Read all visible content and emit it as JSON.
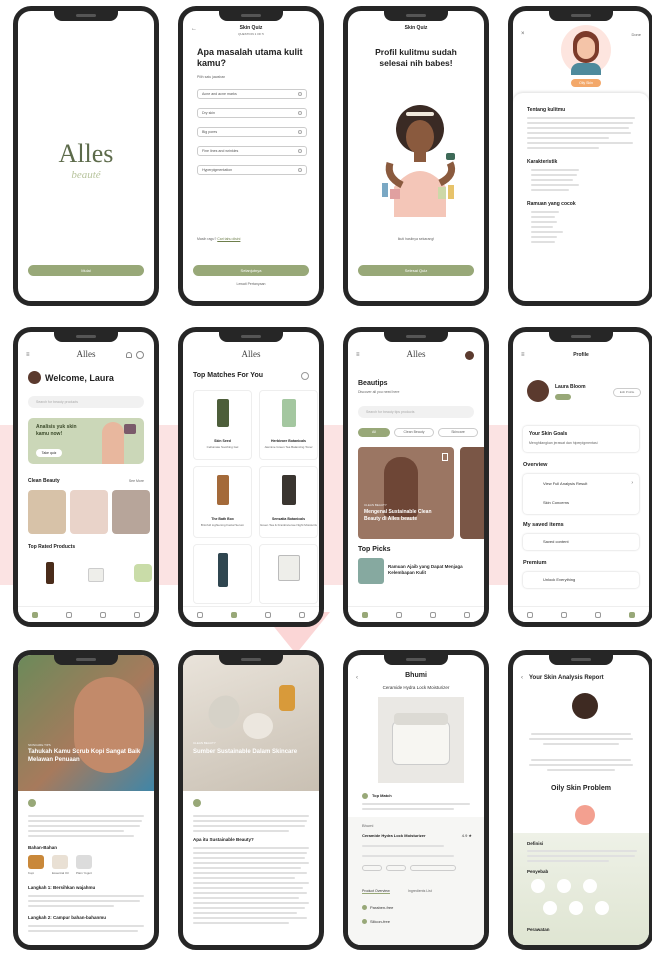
{
  "onboard": {
    "logo": "Alles",
    "logo_sub": "beauté",
    "cta": "Mulai"
  },
  "quiz": {
    "header": "Skin Quiz",
    "step": "QUESTION 1 OF 5",
    "question": "Apa masalah utama kulit kamu?",
    "hint": "Pilih satu jawaban",
    "options": [
      "Acne and acne marks",
      "Dry skin",
      "Big pores",
      "Fine lines and wrinkles",
      "Hyperpigmentation"
    ],
    "footer_q": "Masih ragu?",
    "footer_link": "Cari tahu disini",
    "next": "Selanjutnya",
    "skip": "Lewati Pertanyaan"
  },
  "done": {
    "header": "Skin Quiz",
    "title": "Profil kulitmu sudah selesai nih babes!",
    "sub": "Ikuti hasilnya sekarang!",
    "cta": "Selesai Quiz"
  },
  "detail": {
    "close": "×",
    "done": "Done",
    "badge": "Oily Skin",
    "about_title": "Tentang kulitmu",
    "char_title": "Karakteristik",
    "ing_title": "Ramuan yang cocok"
  },
  "home": {
    "logo": "Alles",
    "welcome": "Welcome, Laura",
    "search": "Search for beauty products",
    "promo": "Analisis yuk skin kamu now!",
    "promo_btn": "Take quiz",
    "clean_title": "Clean Beauty",
    "see_all": "See More",
    "top_title": "Top Rated Products"
  },
  "matches": {
    "logo": "Alles",
    "title": "Top Matches For You",
    "products": [
      {
        "name": "Skin Seed",
        "sub": "Cellumate Soothing Gel"
      },
      {
        "name": "Herbivore Botanicals",
        "sub": "Jasmine Green Tea Balancing Toner"
      },
      {
        "name": "The Bath Box",
        "sub": "Brimfull Lightening Facial Serum"
      },
      {
        "name": "Sensatia Botanicals",
        "sub": "Green Tea & Frankincense Night Moisturizer"
      }
    ]
  },
  "tips": {
    "logo": "Alles",
    "title": "Beautips",
    "sub": "Discover all you need here",
    "search": "Search for beauty tips products",
    "chips": [
      "All",
      "Clean Beauty",
      "Skincare"
    ],
    "card_tag": "CLEAN BEAUTY",
    "card_title": "Mengenal Sustainable Clean Beauty di Alles beaute",
    "picks_title": "Top Picks",
    "pick_title": "Ramuan Ajaib yang Dapat Menjaga Kelembapan Kulit"
  },
  "profile": {
    "header": "Profile",
    "name": "Laura Bloom",
    "edit": "Edit Profile",
    "goals": "Your Skin Goals",
    "goals_sub": "Menghilangkan jerawat dan hiperpigmentasi",
    "overview": "Overview",
    "ov_items": [
      "View Full Analysis Result",
      "Skin Concerns"
    ],
    "saved": "My saved items",
    "saved_item": "Saved content",
    "premium": "Premium",
    "premium_item": "Unlock Everything"
  },
  "article1": {
    "tag": "SKINCARE TIPS",
    "title": "Tahukah Kamu Scrub Kopi Sangat Baik Melawan Penuaan",
    "ing_title": "Bahan-Bahan",
    "ing": [
      "Kopi",
      "Essential Oil",
      "Plain Yogurt"
    ],
    "step1": "Langkah 1: Bersihkan wajahmu",
    "step2": "Langkah 2: Campur bahan-bahanmu"
  },
  "article2": {
    "tag": "CLEAN BEAUTY",
    "title": "Sumber Sustainable Dalam Skincare",
    "q": "Apa itu Sustainable Beauty?"
  },
  "product": {
    "brand": "Bhumi",
    "name": "Ceramide Hydra Lock Moisturizer",
    "match": "Top Match",
    "brand2": "Bhumi",
    "name2": "Ceramide Hydra Lock Moisturizer",
    "price": "4.9",
    "tab1": "Product Overview",
    "tab2": "Ingredients List",
    "free1": "Paraben-free",
    "free2": "Silicon-free"
  },
  "report": {
    "title": "Your Skin Analysis Report",
    "type": "Oily Skin Problem",
    "def": "Definisi",
    "cause": "Penyebab",
    "care": "Perawatan"
  }
}
